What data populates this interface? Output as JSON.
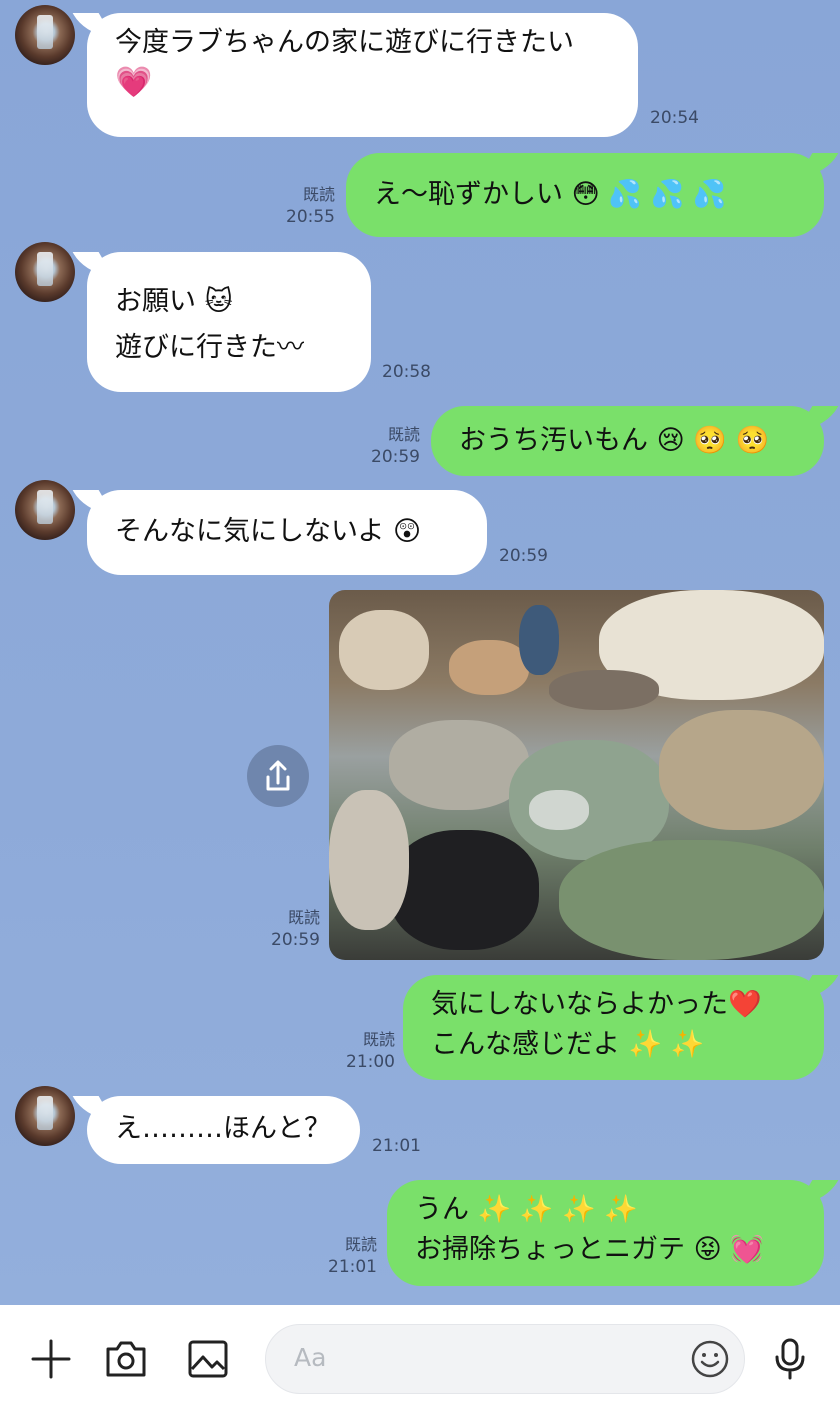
{
  "messages": [
    {
      "side": "in",
      "lines": [
        "今度ラブちゃんの家に遊びに行きたい",
        "💗"
      ],
      "time": "20:54"
    },
    {
      "side": "out",
      "lines": [
        "え〜恥ずかしい 😳 💦 💦 💦"
      ],
      "read": "既読",
      "time": "20:55"
    },
    {
      "side": "in",
      "lines": [
        "お願い 🐱",
        "遊びに行きた〰"
      ],
      "time": "20:58"
    },
    {
      "side": "out",
      "lines": [
        "おうち汚いもん 😢 🥺 🥺"
      ],
      "read": "既読",
      "time": "20:59"
    },
    {
      "side": "in",
      "lines": [
        "そんなに気にしないよ 😲"
      ],
      "time": "20:59"
    },
    {
      "side": "out",
      "type": "image",
      "read": "既読",
      "time": "20:59"
    },
    {
      "side": "out",
      "lines": [
        "気にしないならよかった❤️",
        "こんな感じだよ ✨ ✨"
      ],
      "read": "既読",
      "time": "21:00"
    },
    {
      "side": "in",
      "lines": [
        "え………ほんと？"
      ],
      "time": "21:01"
    },
    {
      "side": "out",
      "lines": [
        "うん ✨ ✨ ✨ ✨",
        "お掃除ちょっとニガテ 😝 💓"
      ],
      "read": "既読",
      "time": "21:01"
    }
  ],
  "composer": {
    "placeholder": "Aa"
  },
  "toolbar": {
    "icons": [
      "plus-icon",
      "camera-icon",
      "image-icon",
      "emoji-icon",
      "mic-icon"
    ]
  },
  "colors": {
    "background": "#8aa7d8",
    "incoming": "#ffffff",
    "outgoing": "#7ae06a"
  }
}
